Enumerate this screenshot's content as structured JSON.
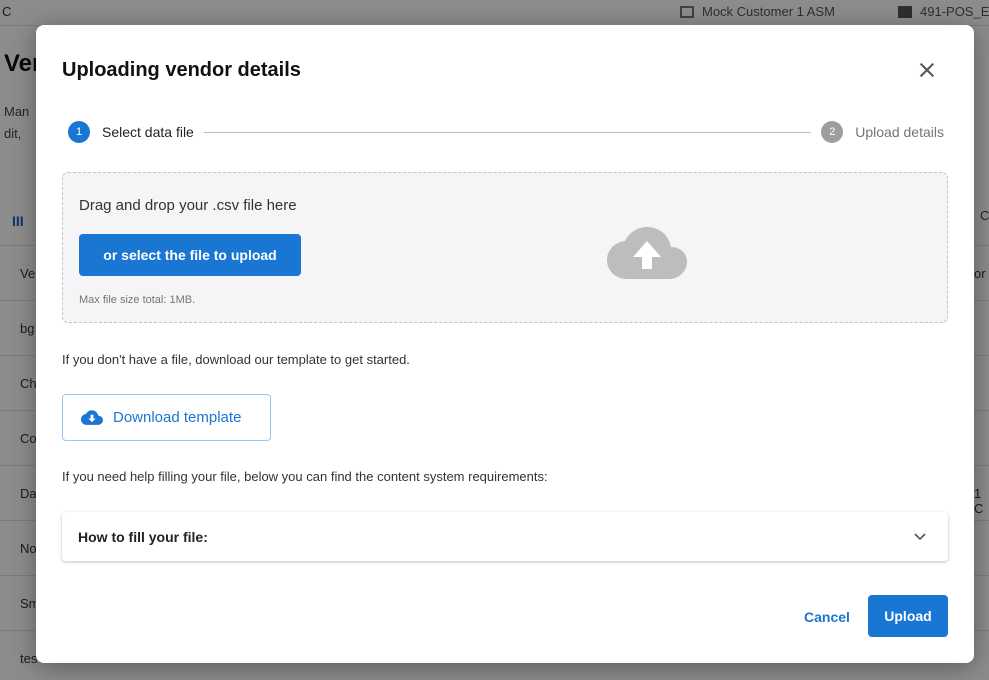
{
  "background": {
    "top_left_char": "C",
    "customer": "Mock Customer 1 ASM",
    "store": "491-POS_E",
    "page_title_fragment": "Ver",
    "desc_line1_fragment": "Man",
    "desc_line2_fragment": "dit,",
    "column_icon": "III",
    "right_header_fragment": "C",
    "rows": [
      {
        "left": "Ve",
        "right": "or"
      },
      {
        "left": "bg",
        "right": ""
      },
      {
        "left": "Ch",
        "right": ""
      },
      {
        "left": "Co",
        "right": ""
      },
      {
        "left": "Da",
        "right": "1 C"
      },
      {
        "left": "No",
        "right": ""
      },
      {
        "left": "Sm",
        "right": ""
      },
      {
        "left": "tes",
        "right": ""
      }
    ]
  },
  "modal": {
    "title": "Uploading vendor details",
    "stepper": {
      "steps": [
        {
          "number": "1",
          "label": "Select data file"
        },
        {
          "number": "2",
          "label": "Upload details"
        }
      ]
    },
    "dropzone": {
      "text": "Drag and drop your .csv file here",
      "select_button": "or select the file to upload",
      "max_size": "Max file size total: 1MB."
    },
    "template_info": "If you don't have a file, download our template to get started.",
    "download_button": "Download template",
    "help_info": "If you need help filling your file, below you can find the content system requirements:",
    "accordion_label": "How to fill your file:",
    "cancel_button": "Cancel",
    "upload_button": "Upload"
  },
  "colors": {
    "primary": "#1976d2",
    "inactive_step": "#9e9e9e",
    "dropzone_bg": "#f5f5f7",
    "cloud_icon": "#bdbdbd"
  },
  "icons": {
    "close": "close-icon",
    "cloud_upload": "cloud-upload-icon",
    "download": "cloud-download-icon",
    "chevron": "chevron-down-icon"
  }
}
